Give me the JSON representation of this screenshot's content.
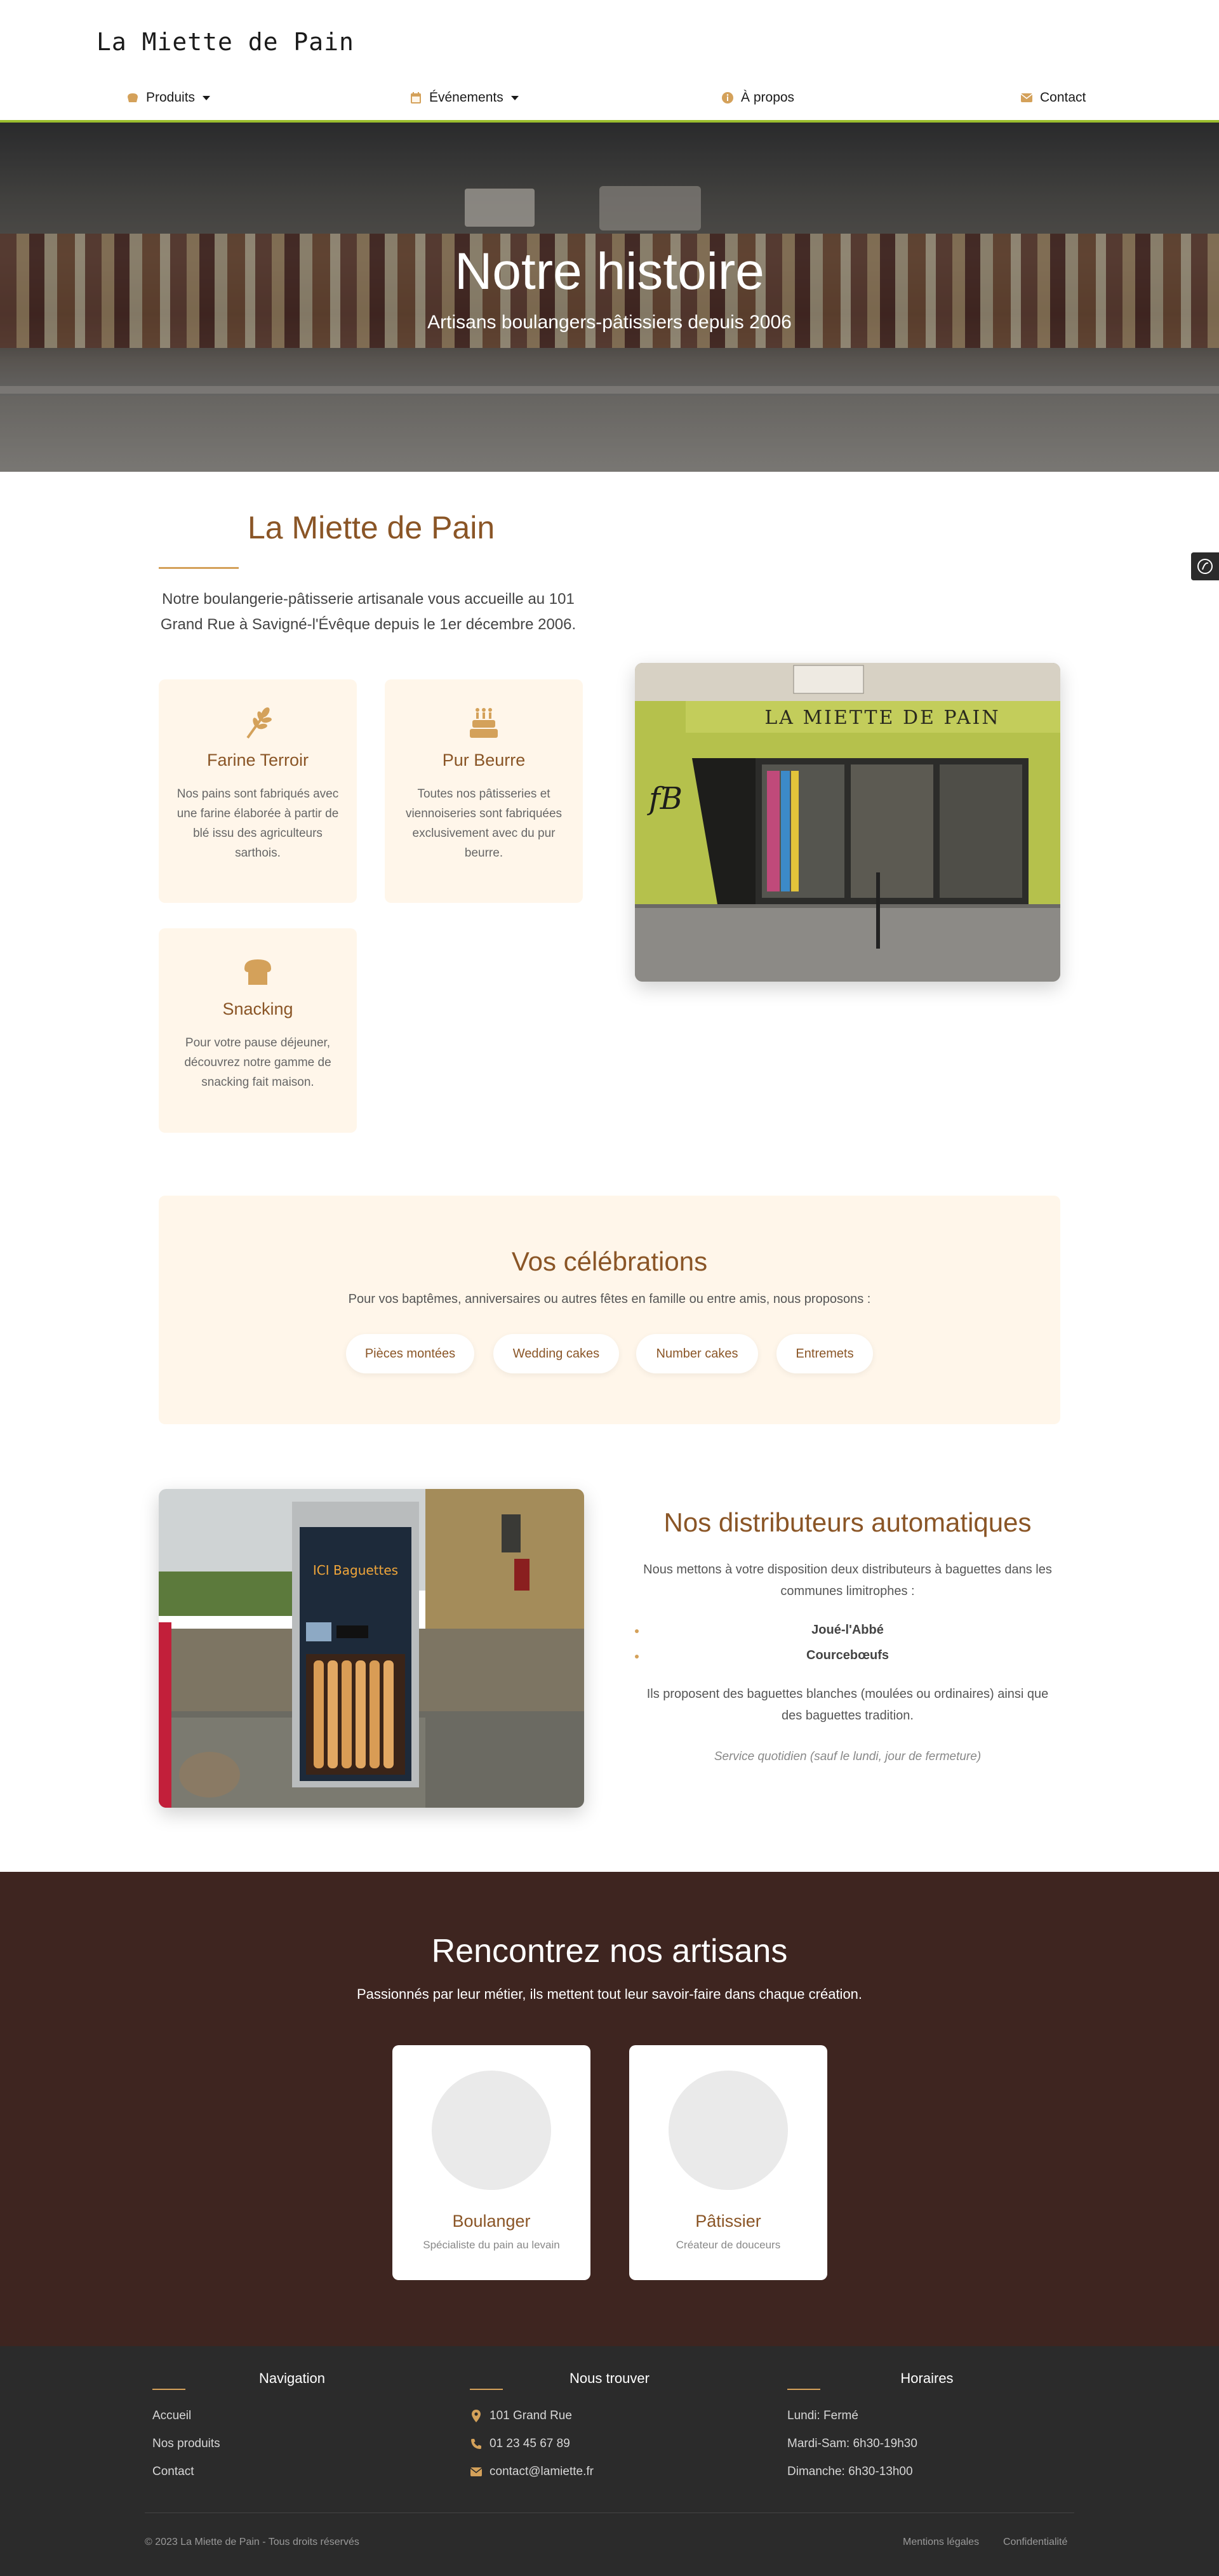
{
  "header": {
    "logo": "La Miette de Pain",
    "nav": [
      {
        "label": "Produits",
        "icon": "bread-icon"
      },
      {
        "label": "Événements",
        "icon": "calendar-icon"
      },
      {
        "label": "À propos",
        "icon": "info-icon"
      },
      {
        "label": "Contact",
        "icon": "envelope-icon"
      }
    ]
  },
  "hero": {
    "title": "Notre histoire",
    "subtitle": "Artisans boulangers-pâtissiers depuis 2006"
  },
  "intro": {
    "title": "La Miette de Pain",
    "text": "Notre boulangerie-pâtisserie artisanale vous accueille au 101 Grand Rue à Savigné-l'Évêque depuis le 1er décembre 2006.",
    "storefront_sign": "LA MIETTE DE PAIN"
  },
  "features": [
    {
      "title": "Farine Terroir",
      "text": "Nos pains sont fabriqués avec une farine élaborée à partir de blé issu des agriculteurs sarthois.",
      "icon": "wheat-icon"
    },
    {
      "title": "Pur Beurre",
      "text": "Toutes nos pâtisseries et viennoiseries sont fabriquées exclusivement avec du pur beurre.",
      "icon": "cake-icon"
    },
    {
      "title": "Snacking",
      "text": "Pour votre pause déjeuner, découvrez notre gamme de snacking fait maison.",
      "icon": "bread-loaf-icon"
    }
  ],
  "celebrations": {
    "title": "Vos célébrations",
    "text": "Pour vos baptêmes, anniversaires ou autres fêtes en famille ou entre amis, nous proposons :",
    "items": [
      "Pièces montées",
      "Wedding cakes",
      "Number cakes",
      "Entremets"
    ]
  },
  "distributors": {
    "title": "Nos distributeurs automatiques",
    "text": "Nous mettons à votre disposition deux distributeurs à baguettes dans les communes limitrophes :",
    "locations": [
      "Joué-l'Abbé",
      "Courcebœufs"
    ],
    "details": "Ils proposent des baguettes blanches (moulées ou ordinaires) ainsi que des baguettes tradition.",
    "note": "Service quotidien (sauf le lundi, jour de fermeture)",
    "machine_sign": "ICI Baguettes"
  },
  "artisans": {
    "title": "Rencontrez nos artisans",
    "subtitle": "Passionnés par leur métier, ils mettent tout leur savoir-faire dans chaque création.",
    "cards": [
      {
        "role": "Boulanger",
        "desc": "Spécialiste du pain au levain"
      },
      {
        "role": "Pâtissier",
        "desc": "Créateur de douceurs"
      }
    ]
  },
  "footer": {
    "navigation": {
      "title": "Navigation",
      "links": [
        "Accueil",
        "Nos produits",
        "Contact"
      ]
    },
    "find_us": {
      "title": "Nous trouver",
      "address": "101 Grand Rue",
      "phone": "01 23 45 67 89",
      "email": "contact@lamiette.fr"
    },
    "hours": {
      "title": "Horaires",
      "lines": [
        "Lundi: Fermé",
        "Mardi-Sam: 6h30-19h30",
        "Dimanche: 6h30-13h00"
      ]
    },
    "copyright": "© 2023 La Miette de Pain - Tous droits réservés",
    "legal": [
      "Mentions légales",
      "Confidentialité"
    ]
  },
  "colors": {
    "accent": "#8a5526",
    "gold": "#d4a15a",
    "cream": "#fff6ea",
    "header_border": "#9bbd2e",
    "artisans_bg": "#3e2520",
    "footer_bg": "#2b2b2b"
  }
}
